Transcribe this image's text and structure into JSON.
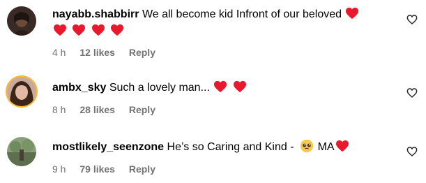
{
  "comments": [
    {
      "username": "nayabb.shabbirr",
      "text": "We all become kid Infront of our beloved",
      "time": "4 h",
      "likes": "12 likes",
      "reply": "Reply",
      "avatar_icon": "profile-photo",
      "heart_count": 5
    },
    {
      "username": "ambx_sky",
      "text": "Such a lovely man...",
      "time": "8 h",
      "likes": "28 likes",
      "reply": "Reply",
      "avatar_icon": "profile-photo",
      "heart_count": 2
    },
    {
      "username": "mostlikely_seenzone",
      "text": "He’s so Caring and Kind -",
      "text_after": "MA",
      "time": "9 h",
      "likes": "79 likes",
      "reply": "Reply",
      "avatar_icon": "profile-photo",
      "heart_count": 1
    }
  ],
  "colors": {
    "heart": "#ff3040",
    "meta": "#737373",
    "story_ring": "#f7b733"
  },
  "icons": {
    "like": "heart-outline-icon",
    "inline_heart": "red-heart-emoji",
    "face": "pleading-face-emoji"
  }
}
